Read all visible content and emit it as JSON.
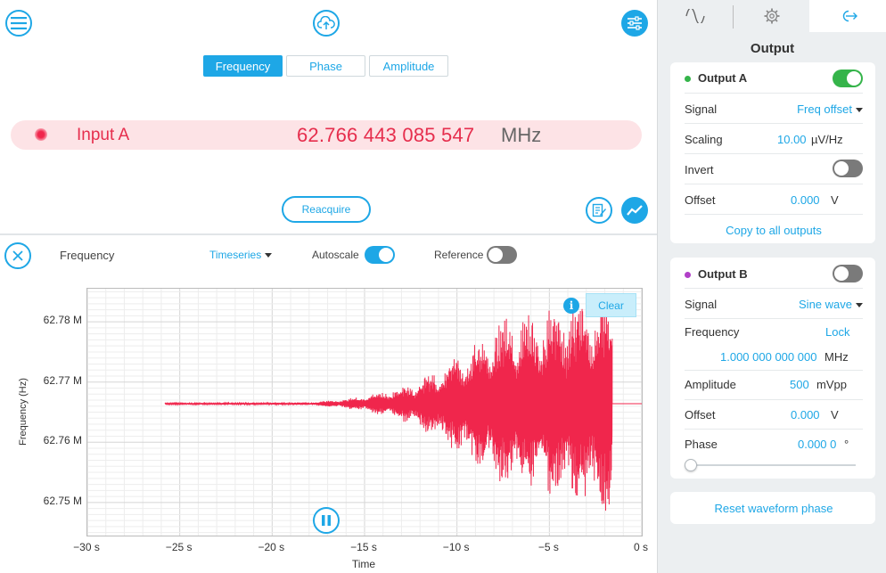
{
  "header": {
    "tabs": [
      {
        "label": "Frequency",
        "active": true
      },
      {
        "label": "Phase",
        "active": false
      },
      {
        "label": "Amplitude",
        "active": false
      }
    ]
  },
  "input": {
    "name": "Input A",
    "value": "62.766 443 085 547",
    "unit": "MHz",
    "color": "#e62e4d"
  },
  "reacquire_label": "Reacquire",
  "plot_toolbar": {
    "title": "Frequency",
    "view_mode": "Timeseries",
    "autoscale_label": "Autoscale",
    "autoscale_on": true,
    "reference_label": "Reference",
    "reference_on": false
  },
  "clear_label": "Clear",
  "info_label": "i",
  "chart_data": {
    "type": "line",
    "xlabel": "Time",
    "ylabel": "Frequency (Hz)",
    "xlim": [
      -30,
      0
    ],
    "ylim": [
      62.7445,
      62.7855
    ],
    "x_tick_labels": [
      "−30 s",
      "−25 s",
      "−20 s",
      "−15 s",
      "−10 s",
      "−5 s",
      "0 s"
    ],
    "y_tick_labels": [
      "62.78 M",
      "62.77 M",
      "62.76 M",
      "62.75 M"
    ],
    "y_tick_values_mhz": [
      62.78,
      62.77,
      62.76,
      62.75
    ],
    "grid": true,
    "series": [
      {
        "color": "#f0264c",
        "x_start": -25.8,
        "x_end": -1.6,
        "baseline": 62.7664,
        "envelope": [
          [
            -25.8,
            0.0001
          ],
          [
            -18,
            0.0002
          ],
          [
            -16,
            0.0008
          ],
          [
            -15,
            0.0014
          ],
          [
            -13.5,
            0.0025
          ],
          [
            -12.5,
            0.0035
          ],
          [
            -11,
            0.006
          ],
          [
            -10,
            0.009
          ],
          [
            -9,
            0.011
          ],
          [
            -8,
            0.014
          ],
          [
            -7,
            0.016
          ],
          [
            -6,
            0.015
          ],
          [
            -5,
            0.017
          ],
          [
            -3.5,
            0.0185
          ],
          [
            -2.5,
            0.019
          ],
          [
            -1.6,
            0.02
          ]
        ],
        "tail_value": 62.7664,
        "tail_x_end": 0
      }
    ]
  },
  "sidebar": {
    "title": "Output",
    "output_a": {
      "label": "Output A",
      "dot_color": "#35b44a",
      "enabled": true,
      "signal_label": "Signal",
      "signal_value": "Freq offset",
      "scaling_label": "Scaling",
      "scaling_value": "10.00",
      "scaling_unit": "µV/Hz",
      "invert_label": "Invert",
      "invert_on": false,
      "offset_label": "Offset",
      "offset_value": "0.000",
      "offset_unit": "V",
      "copy_label": "Copy to all outputs"
    },
    "output_b": {
      "label": "Output B",
      "dot_color": "#b140c8",
      "enabled": false,
      "signal_label": "Signal",
      "signal_value": "Sine wave",
      "frequency_label": "Frequency",
      "lock_label": "Lock",
      "frequency_value": "1.000 000 000 000",
      "frequency_unit": "MHz",
      "amplitude_label": "Amplitude",
      "amplitude_value": "500",
      "amplitude_unit": "mVpp",
      "offset_label": "Offset",
      "offset_value": "0.000",
      "offset_unit": "V",
      "phase_label": "Phase",
      "phase_value": "0.000 0",
      "phase_unit": "°",
      "phase_slider_fraction": 0.0
    },
    "reset_label": "Reset waveform phase"
  }
}
